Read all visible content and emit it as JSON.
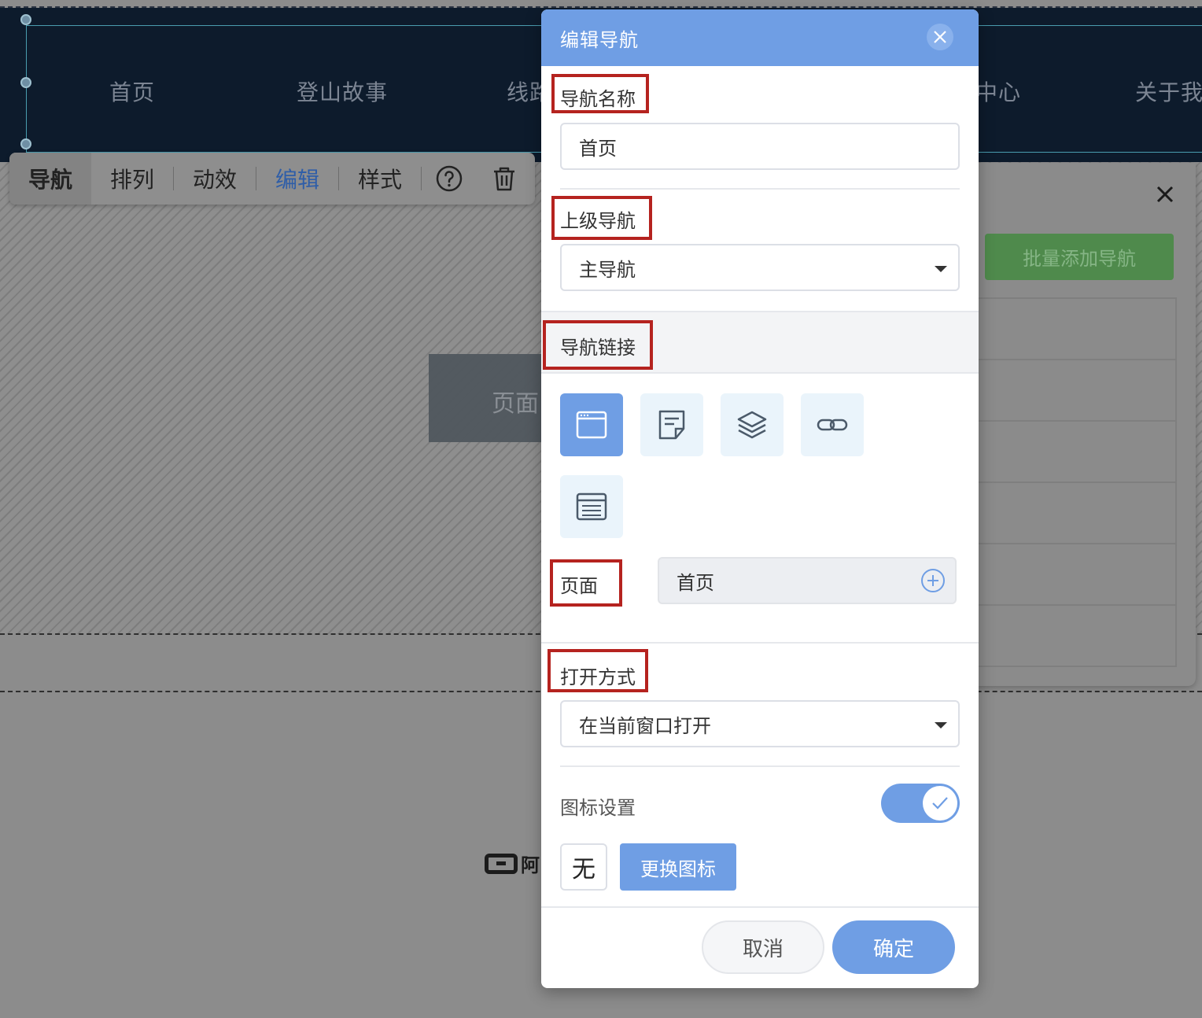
{
  "site_nav": {
    "items": [
      "首页",
      "登山故事",
      "线路",
      "中心",
      "关于我"
    ]
  },
  "toolbar": {
    "tabs": [
      "导航",
      "排列",
      "动效",
      "编辑",
      "样式"
    ],
    "help_icon": "help-circle-icon",
    "delete_icon": "trash-icon"
  },
  "page_block_label": "页面",
  "side_panel": {
    "batch_button": "批量添加导航",
    "close_icon": "close-icon"
  },
  "footer_brand": "阿",
  "dialog": {
    "title": "编辑导航",
    "close_icon": "close-icon",
    "nav_name_label": "导航名称",
    "nav_name_value": "首页",
    "parent_label": "上级导航",
    "parent_value": "主导航",
    "link_label": "导航链接",
    "link_types": [
      "page-icon",
      "article-icon",
      "layers-icon",
      "link-icon",
      "list-page-icon"
    ],
    "selected_link_type": 0,
    "page_label": "页面",
    "page_value": "首页",
    "open_mode_label": "打开方式",
    "open_mode_value": "在当前窗口打开",
    "icon_setting_label": "图标设置",
    "icon_setting_enabled": true,
    "icon_preview": "无",
    "change_icon_button": "更换图标",
    "cancel_button": "取消",
    "confirm_button": "确定"
  },
  "colors": {
    "accent": "#6f9ee4",
    "highlight_box": "#b5231f",
    "nav_bg": "#0d1b2c",
    "batch_green": "#4f8a4c"
  }
}
